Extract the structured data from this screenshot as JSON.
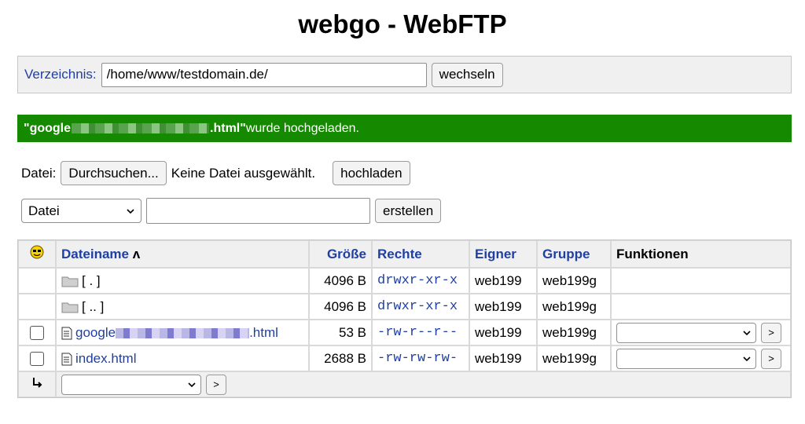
{
  "page": {
    "title": "webgo - WebFTP"
  },
  "directory": {
    "label": "Verzeichnis:",
    "value": "/home/www/testdomain.de/",
    "button": "wechseln"
  },
  "notice": {
    "prefix": "\"google",
    "suffix": ".html\"",
    "message": " wurde hochgeladen.",
    "bg_color": "#158a00"
  },
  "upload": {
    "label": "Datei:",
    "browse_button": "Durchsuchen...",
    "no_file": "Keine Datei ausgewählt.",
    "upload_button": "hochladen"
  },
  "create": {
    "type_selected": "Datei",
    "button": "erstellen"
  },
  "table": {
    "headers": {
      "icon": "smiley-icon",
      "name": "Dateiname",
      "sort_indicator": "ʌ",
      "size": "Größe",
      "perms": "Rechte",
      "owner": "Eigner",
      "group": "Gruppe",
      "functions": "Funktionen"
    },
    "rows": [
      {
        "name": "[ . ]",
        "size": "4096 B",
        "perms": "drwxr-xr-x",
        "owner": "web199",
        "group": "web199g"
      },
      {
        "name": "[ .. ]",
        "size": "4096 B",
        "perms": "drwxr-xr-x",
        "owner": "web199",
        "group": "web199g"
      },
      {
        "name_prefix": "google",
        "name_suffix": ".html",
        "size": "53 B",
        "perms": "-rw-r--r--",
        "owner": "web199",
        "group": "web199g"
      },
      {
        "name": "index.html",
        "size": "2688 B",
        "perms": "-rw-rw-rw-",
        "owner": "web199",
        "group": "web199g"
      }
    ],
    "footer": {
      "go_label": ">"
    },
    "row_go_label": ">"
  },
  "colors": {
    "link": "#1f3fa3",
    "panel": "#f0f0f0"
  }
}
